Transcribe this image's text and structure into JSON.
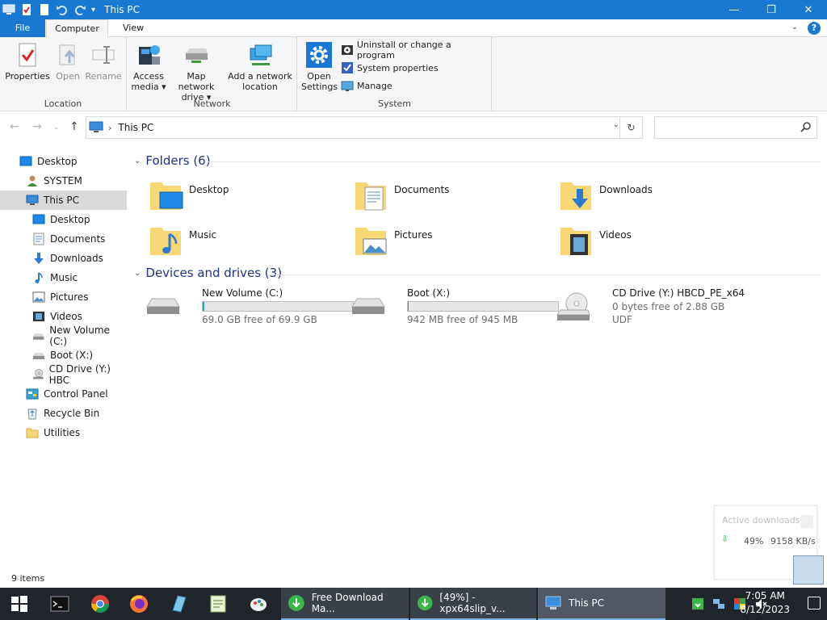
{
  "window": {
    "title": "This PC"
  },
  "tabs": {
    "file": "File",
    "computer": "Computer",
    "view": "View"
  },
  "ribbon": {
    "location": {
      "label": "Location",
      "properties": "Properties",
      "open": "Open",
      "rename": "Rename"
    },
    "network": {
      "label": "Network",
      "access_media_1": "Access",
      "access_media_2": "media ▾",
      "map_drive_1": "Map network",
      "map_drive_2": "drive ▾",
      "add_location_1": "Add a network",
      "add_location_2": "location"
    },
    "open_settings_1": "Open",
    "open_settings_2": "Settings",
    "system": {
      "label": "System",
      "uninstall": "Uninstall or change a program",
      "sys_props": "System properties",
      "manage": "Manage"
    }
  },
  "address": {
    "crumb": "This PC"
  },
  "search": {
    "placeholder": ""
  },
  "nav": [
    {
      "label": "Desktop",
      "icon": "desktop-icon"
    },
    {
      "label": "SYSTEM",
      "icon": "user-icon"
    },
    {
      "label": "This PC",
      "icon": "computer-icon"
    },
    {
      "label": "Desktop",
      "icon": "desktop-icon"
    },
    {
      "label": "Documents",
      "icon": "documents-icon"
    },
    {
      "label": "Downloads",
      "icon": "downloads-icon"
    },
    {
      "label": "Music",
      "icon": "music-icon"
    },
    {
      "label": "Pictures",
      "icon": "pictures-icon"
    },
    {
      "label": "Videos",
      "icon": "videos-icon"
    },
    {
      "label": "New Volume (C:)",
      "icon": "drive-icon"
    },
    {
      "label": "Boot (X:)",
      "icon": "drive-icon"
    },
    {
      "label": "CD Drive (Y:) HBC",
      "icon": "cd-drive-icon"
    },
    {
      "label": "Control Panel",
      "icon": "control-panel-icon"
    },
    {
      "label": "Recycle Bin",
      "icon": "recycle-bin-icon"
    },
    {
      "label": "Utilities",
      "icon": "folder-icon"
    }
  ],
  "folders": {
    "header": "Folders (6)",
    "items": [
      {
        "name": "Desktop",
        "icon": "desktop-folder-icon"
      },
      {
        "name": "Documents",
        "icon": "documents-folder-icon"
      },
      {
        "name": "Downloads",
        "icon": "downloads-folder-icon"
      },
      {
        "name": "Music",
        "icon": "music-folder-icon"
      },
      {
        "name": "Pictures",
        "icon": "pictures-folder-icon"
      },
      {
        "name": "Videos",
        "icon": "videos-folder-icon"
      }
    ]
  },
  "drives": {
    "header": "Devices and drives (3)",
    "items": [
      {
        "name": "New Volume (C:)",
        "free": "69.0 GB free of 69.9 GB",
        "used_fraction": 0.01
      },
      {
        "name": "Boot (X:)",
        "free": "942 MB free of 945 MB",
        "used_fraction": 0.003
      },
      {
        "name": "CD Drive (Y:) HBCD_PE_x64",
        "free": "0 bytes free of 2.88 GB",
        "fs": "UDF"
      }
    ]
  },
  "status": {
    "items": "9 items"
  },
  "downloads_popup": {
    "title": "Active downloads",
    "percent": "49%",
    "speed": "9158 KB/s"
  },
  "taskbar": {
    "tasks": [
      {
        "label": "Free Download Ma..."
      },
      {
        "label": "[49%] - xpx64slip_v..."
      },
      {
        "label": "This PC"
      }
    ],
    "time": "7:05 AM",
    "date": "8/12/2023"
  },
  "colors": {
    "titlebar": "#1979d2",
    "taskbar": "#20252c",
    "section_header": "#1e3287",
    "selected_nav": "#d9d9d9"
  }
}
